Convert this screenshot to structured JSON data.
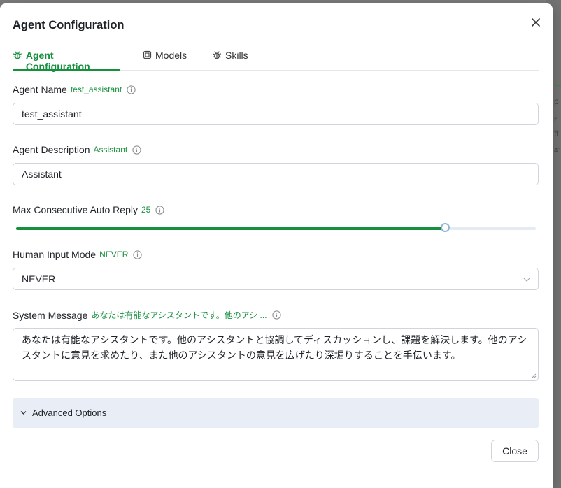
{
  "modal": {
    "title": "Agent Configuration",
    "close_label": "Close"
  },
  "tabs": [
    {
      "label": "Agent Configuration",
      "icon": "bug-icon",
      "active": true
    },
    {
      "label": "Models",
      "icon": "cpu-icon",
      "active": false
    },
    {
      "label": "Skills",
      "icon": "bug-icon",
      "active": false
    }
  ],
  "fields": {
    "agent_name": {
      "label": "Agent Name",
      "value_hint": "test_assistant",
      "value": "test_assistant"
    },
    "agent_description": {
      "label": "Agent Description",
      "value_hint": "Assistant",
      "value": "Assistant"
    },
    "max_reply": {
      "label": "Max Consecutive Auto Reply",
      "value": "25",
      "fill_percent": 82.5
    },
    "human_input": {
      "label": "Human Input Mode",
      "value_hint": "NEVER",
      "value": "NEVER"
    },
    "system_message": {
      "label": "System Message",
      "value_hint": "あなたは有能なアシスタントです。他のアシ ...",
      "value": "あなたは有能なアシスタントです。他のアシスタントと協調してディスカッションし、課題を解決します。他のアシスタントに意見を求めたり、また他のアシスタントの意見を広げたり深堀りすることを手伝います。"
    }
  },
  "advanced": {
    "label": "Advanced Options"
  },
  "colors": {
    "accent": "#17903e",
    "slider_handle": "#8fb6d9",
    "advanced_bg": "#e9eef6"
  },
  "background": {
    "peek_texts": [
      "p",
      "r",
      "ff",
      "41"
    ]
  }
}
